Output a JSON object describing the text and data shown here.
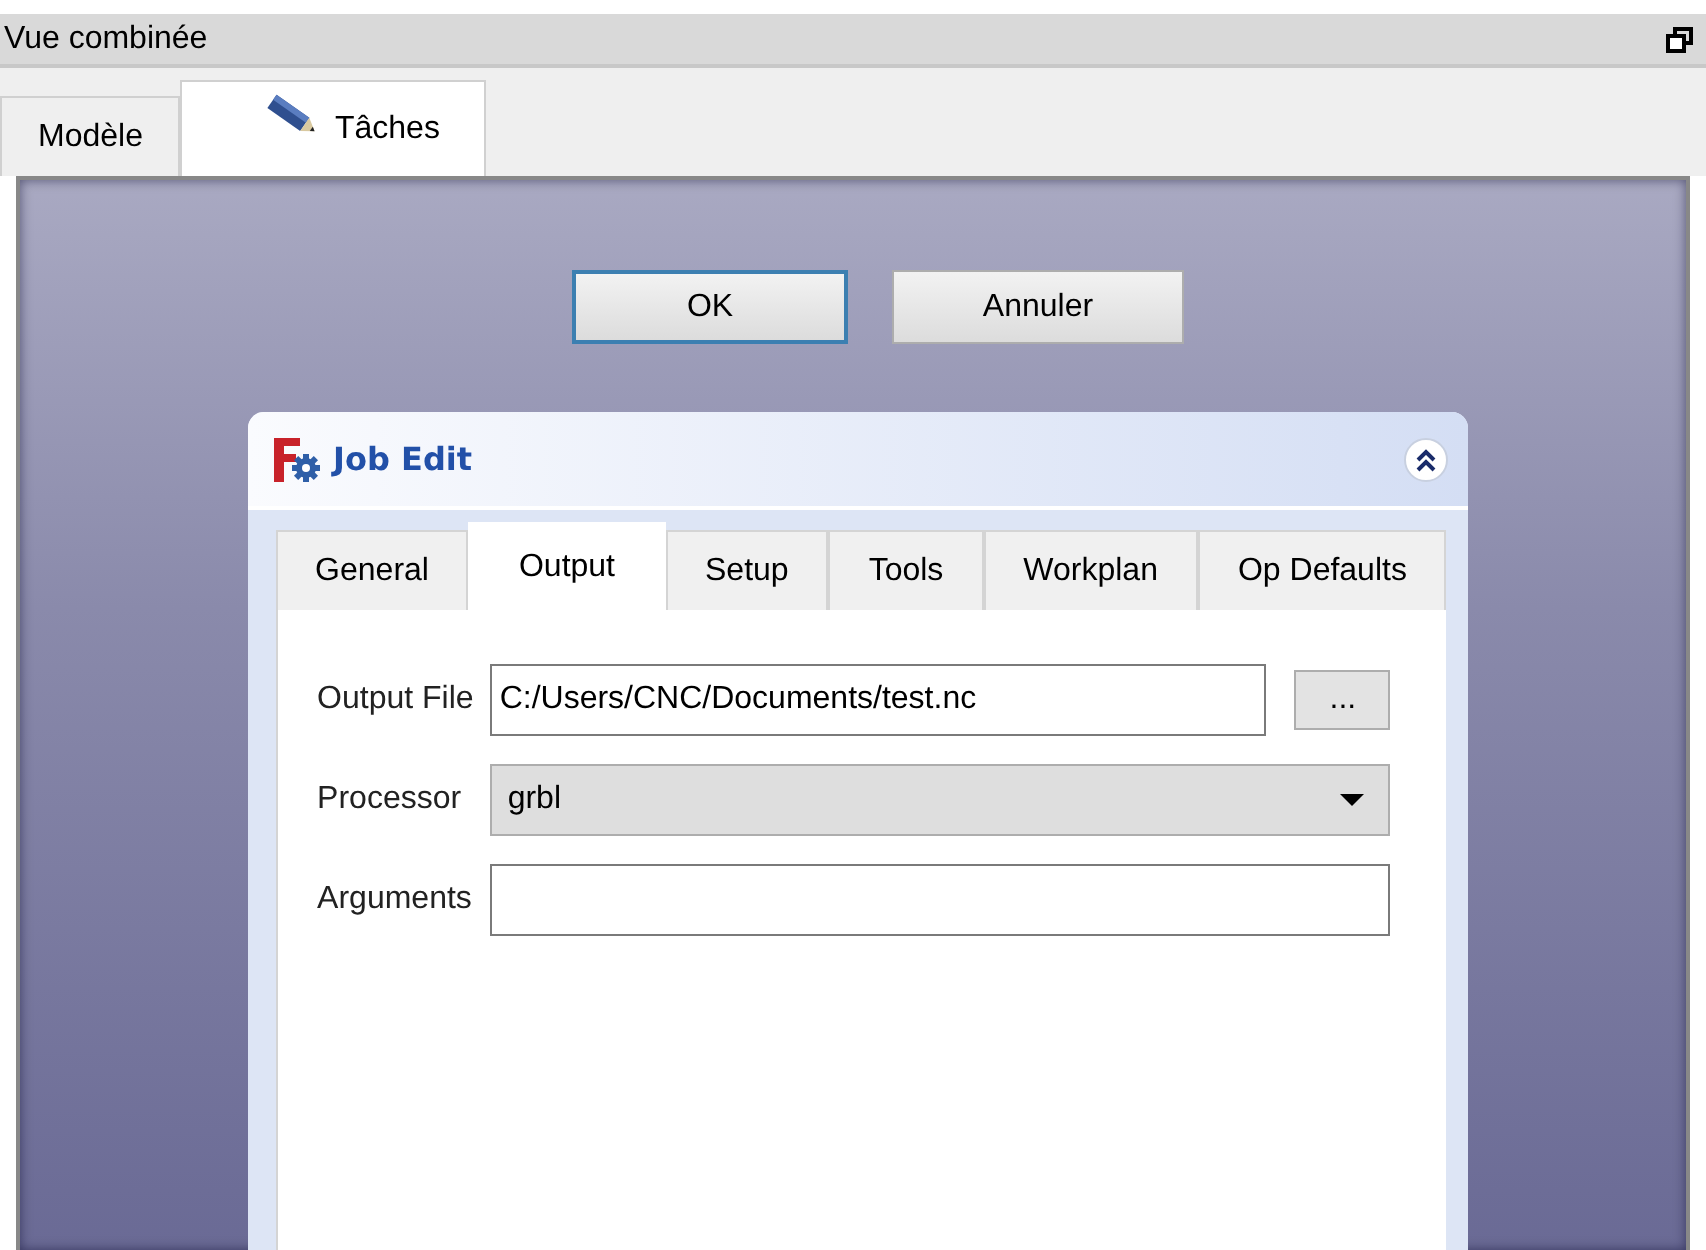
{
  "window": {
    "title": "Vue combinée"
  },
  "tabs": [
    {
      "label": "Modèle",
      "kind": "text",
      "selected": false
    },
    {
      "label": "Tâches",
      "kind": "icon_text",
      "selected": true
    }
  ],
  "buttons": [
    {
      "label": "OK",
      "default": true
    },
    {
      "label": "Annuler",
      "default": false
    }
  ],
  "job_edit": {
    "title": "Job Edit",
    "expanded": true,
    "tabs": [
      {
        "label": "General",
        "selected": false
      },
      {
        "label": "Output",
        "selected": true
      },
      {
        "label": "Setup",
        "selected": false
      },
      {
        "label": "Tools",
        "selected": false
      },
      {
        "label": "Workplan",
        "selected": false
      },
      {
        "label": "Op Defaults",
        "selected": false
      }
    ],
    "fields": [
      {
        "kind": "file",
        "label": "Output File",
        "value": "C:/Users/CNC/Documents/test.nc",
        "browse": "..."
      },
      {
        "kind": "combo",
        "label": "Processor",
        "value": "grbl"
      },
      {
        "kind": "text",
        "label": "Arguments"
      }
    ]
  }
}
